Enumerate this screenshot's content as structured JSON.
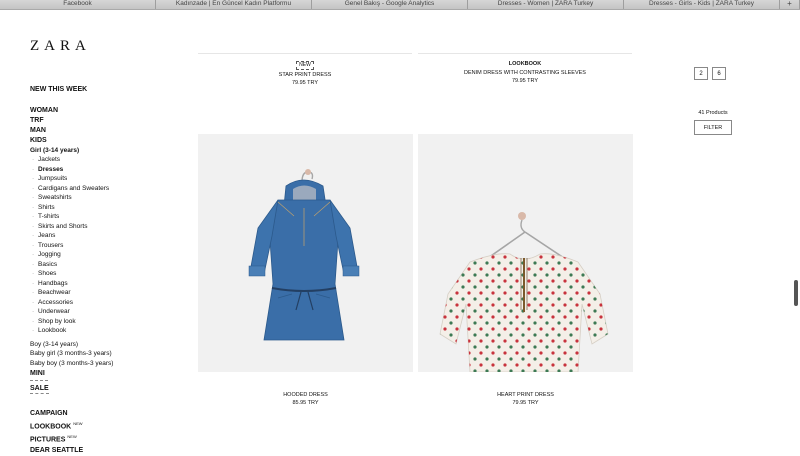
{
  "browser": {
    "tabs": [
      "Facebook",
      "Kadınzade | En Güncel Kadın Platformu",
      "Genel Bakış - Google Analytics",
      "Dresses - Women | ZARA Turkey",
      "Dresses - Girls - Kids | ZARA Turkey"
    ],
    "new_tab": "+"
  },
  "logo": "ZARA",
  "nav": {
    "new_this_week": "NEW THIS WEEK",
    "categories": [
      "WOMAN",
      "TRF",
      "MAN",
      "KIDS"
    ],
    "girl_label": "Girl (3-14 years)",
    "girl_items": [
      "Jackets",
      "Dresses",
      "Jumpsuits",
      "Cardigans and Sweaters",
      "Sweatshirts",
      "Shirts",
      "T-shirts",
      "Skirts and Shorts",
      "Jeans",
      "Trousers",
      "Jogging",
      "Basics",
      "Shoes",
      "Handbags",
      "Beachwear",
      "Accessories",
      "Underwear",
      "Shop by look",
      "Lookbook"
    ],
    "other_kids": [
      "Boy (3-14 years)",
      "Baby girl (3 months-3 years)",
      "Baby boy (3 months-3 years)"
    ],
    "mini": "MINI",
    "sale": "SALE",
    "bottom": [
      "CAMPAIGN",
      "LOOKBOOK",
      "PICTURES",
      "DEAR SEATTLE"
    ],
    "new_badge": "NEW"
  },
  "top_products": [
    {
      "tag": "NEW",
      "name": "STAR PRINT DRESS",
      "price": "79.95 TRY"
    },
    {
      "tag": "LOOKBOOK",
      "name": "DENIM DRESS WITH CONTRASTING SLEEVES",
      "price": "79.95 TRY"
    }
  ],
  "products": [
    {
      "name": "HOODED DRESS",
      "price": "85.95 TRY"
    },
    {
      "name": "HEART PRINT DRESS",
      "price": "79.95 TRY"
    }
  ],
  "controls": {
    "view_options": [
      "2",
      "6"
    ],
    "product_count": "41 Products",
    "filter_label": "FILTER"
  },
  "colors": {
    "denim": "#3a6ea8",
    "heart_dot": "#c8333d",
    "green_dot": "#3d7a54"
  }
}
